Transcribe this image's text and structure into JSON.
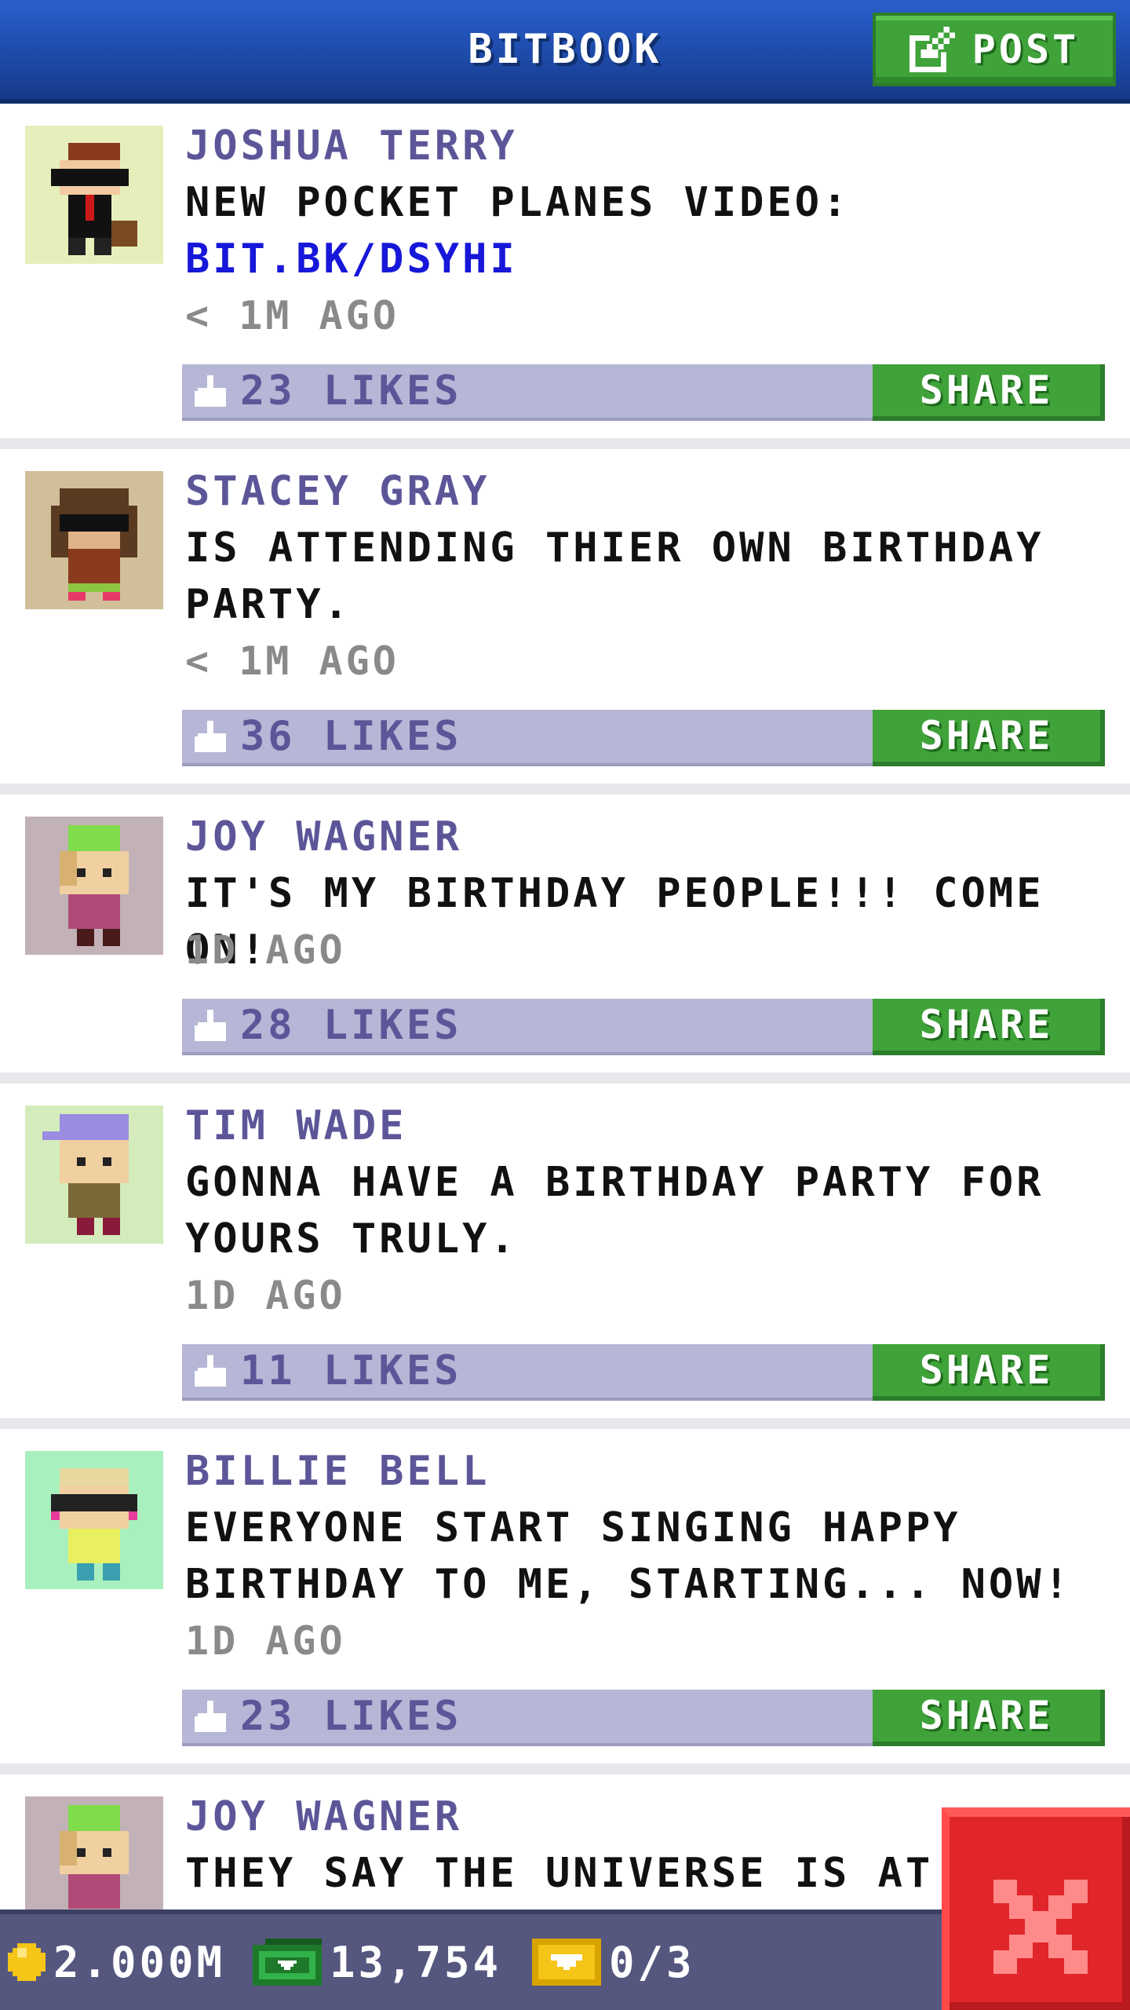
{
  "header": {
    "title": "BITBOOK",
    "post_label": "POST"
  },
  "posts": [
    {
      "name": "JOSHUA TERRY",
      "text": "NEW POCKET PLANES VIDEO:",
      "link": "BIT.BK/DSYHI",
      "time": "< 1M AGO",
      "likes": "23 LIKES",
      "share": "SHARE",
      "avatar_bg": "#e6efbb"
    },
    {
      "name": "STACEY GRAY",
      "text": "IS ATTENDING THIER OWN BIRTHDAY PARTY.",
      "time": "< 1M AGO",
      "likes": "36 LIKES",
      "share": "SHARE",
      "avatar_bg": "#d1bf99"
    },
    {
      "name": "JOY WAGNER",
      "text": "IT'S MY BIRTHDAY PEOPLE!!! COME ON!",
      "time": "1D AGO",
      "likes": "28 LIKES",
      "share": "SHARE",
      "avatar_bg": "#c2b2b8"
    },
    {
      "name": "TIM WADE",
      "text": "GONNA HAVE A BIRTHDAY PARTY FOR YOURS TRULY.",
      "time": "1D AGO",
      "likes": "11 LIKES",
      "share": "SHARE",
      "avatar_bg": "#d4ecbb"
    },
    {
      "name": "BILLIE BELL",
      "text": "EVERYONE START SINGING HAPPY BIRTHDAY TO ME, STARTING... NOW!",
      "time": "1D AGO",
      "likes": "23 LIKES",
      "share": "SHARE",
      "avatar_bg": "#a9f0bf"
    },
    {
      "name": "JOY WAGNER",
      "text": "THEY SAY THE UNIVERSE IS AT I",
      "avatar_bg": "#c2b2b8"
    }
  ],
  "bottom_bar": {
    "coins": "2.000M",
    "bux": "13,754",
    "tickets": "0/3"
  },
  "colors": {
    "header_blue": "#1d49a7",
    "accent_green": "#3fa33a",
    "name_purple": "#5c5699",
    "link_blue": "#1717d9",
    "like_bar": "#b6b6d6",
    "close_red": "#e0262a"
  },
  "icons": [
    "edit-icon",
    "thumbs-up-icon",
    "coin-icon",
    "bux-icon",
    "ticket-icon",
    "close-icon"
  ]
}
